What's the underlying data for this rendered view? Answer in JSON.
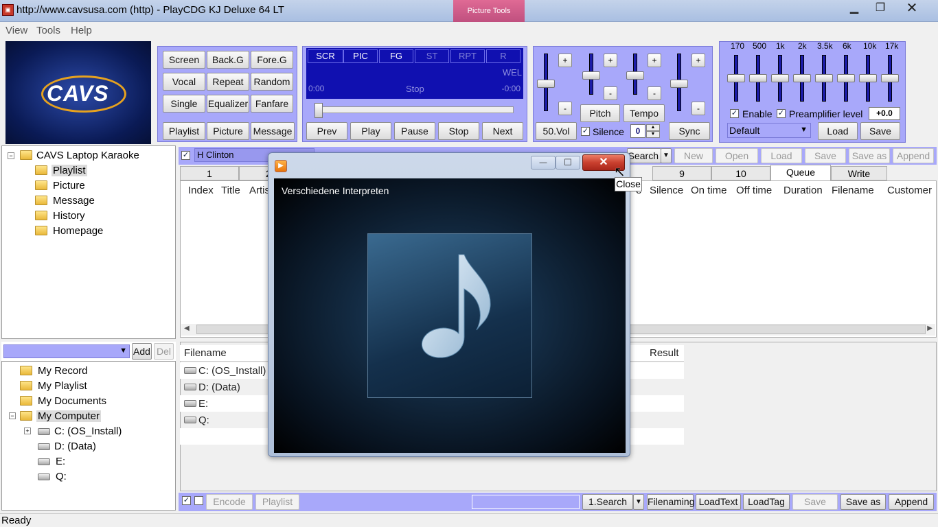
{
  "window": {
    "title": "http://www.cavsusa.com (http) - PlayCDG KJ Deluxe 64 LT",
    "picture_tools": "Picture Tools"
  },
  "menu": [
    "View",
    "Tools",
    "Help"
  ],
  "logo_text": "CAVS",
  "controls": {
    "row1": [
      "Screen",
      "Back.G",
      "Fore.G"
    ],
    "row2": [
      "Vocal",
      "Repeat",
      "Random"
    ],
    "row3": [
      "Single",
      "Equalizer",
      "Fanfare"
    ],
    "row4": [
      "Playlist",
      "Picture",
      "Message"
    ]
  },
  "lcd": {
    "tabs": [
      "SCR",
      "PIC",
      "FG",
      "ST",
      "RPT",
      "R"
    ],
    "scroll_text": "WEL",
    "time_left": "0:00",
    "state": "Stop",
    "time_right": "-0:00"
  },
  "transport": [
    "Prev",
    "Play",
    "Pause",
    "Stop",
    "Next"
  ],
  "mixer": {
    "plus": "+",
    "minus": "-",
    "pitch": "Pitch",
    "tempo": "Tempo",
    "vol": "50.Vol",
    "silence": "Silence",
    "silence_value": "0",
    "sync": "Sync"
  },
  "eq": {
    "bands": [
      "170",
      "500",
      "1k",
      "2k",
      "3.5k",
      "6k",
      "10k",
      "17k"
    ],
    "enable": "Enable",
    "preamp": "Preamplifier level",
    "preamp_value": "+0.0",
    "preset": "Default",
    "load": "Load",
    "save": "Save"
  },
  "left_tree": {
    "root": "CAVS Laptop Karaoke",
    "items": [
      "Playlist",
      "Picture",
      "Message",
      "History",
      "Homepage"
    ]
  },
  "playlist_bar": {
    "name": "H Clinton",
    "search": "Search",
    "buttons": [
      "New",
      "Open",
      "Load",
      "Save",
      "Save as",
      "Append"
    ]
  },
  "tabs": {
    "first": "1",
    "second": "2",
    "nine": "9",
    "ten": "10",
    "queue": "Queue",
    "write": "Write"
  },
  "columns_left": [
    "Index",
    "Title",
    "Artis"
  ],
  "columns_right": [
    "e",
    "Silence",
    "On time",
    "Off time",
    "Duration",
    "Filename",
    "Customer"
  ],
  "file_panel": {
    "add": "Add",
    "del": "Del",
    "items": [
      "My Record",
      "My Playlist",
      "My Documents",
      "My Computer"
    ],
    "drives": [
      "C: (OS_Install)",
      "D: (Data)",
      "E:",
      "Q:"
    ]
  },
  "file_list": {
    "header_filename": "Filename",
    "header_result": "Result",
    "rows": [
      "C: (OS_Install)",
      "D: (Data)",
      "E:",
      "Q:"
    ]
  },
  "bottom_bar": {
    "encode": "Encode",
    "playlist": "Playlist",
    "search": "1.Search",
    "buttons": [
      "Filenaming",
      "LoadText",
      "LoadTag",
      "Save",
      "Save as",
      "Append"
    ]
  },
  "status": "Ready",
  "popup": {
    "artist": "Verschiedene Interpreten",
    "tooltip": "Close",
    "minimize": "—",
    "maximize": "☐",
    "close": "✕"
  },
  "colors": {
    "panel": "#a8a8fa",
    "lcd": "#1010b0",
    "close_red": "#c9402f"
  }
}
